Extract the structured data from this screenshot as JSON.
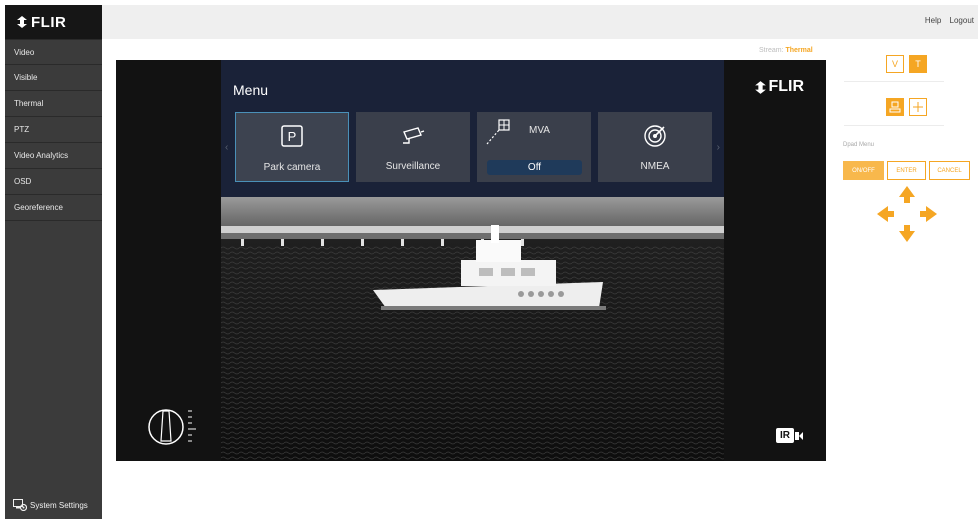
{
  "brand": {
    "logo_text": "FLIR"
  },
  "sidebar": {
    "items": [
      {
        "label": "Video"
      },
      {
        "label": "Visible"
      },
      {
        "label": "Thermal"
      },
      {
        "label": "PTZ"
      },
      {
        "label": "Video Analytics"
      },
      {
        "label": "OSD"
      },
      {
        "label": "Georeference"
      }
    ],
    "footer_label": "System Settings"
  },
  "topbar": {
    "help_label": "Help",
    "logout_label": "Logout"
  },
  "stream": {
    "label": "Stream:",
    "value": "Thermal"
  },
  "video": {
    "menu": {
      "title": "Menu",
      "items": [
        {
          "label": "Park camera",
          "icon": "park-icon",
          "selected": true
        },
        {
          "label": "Surveillance",
          "icon": "surveillance-camera-icon",
          "selected": false
        },
        {
          "label": "MVA",
          "icon": "mva-icon",
          "value": "Off",
          "selected": false
        },
        {
          "label": "NMEA",
          "icon": "nmea-radar-icon",
          "selected": false
        }
      ],
      "left_arrow": "‹",
      "right_arrow": "›"
    },
    "overlay_logo": "FLIR",
    "ir_badge": "IR"
  },
  "controls": {
    "stream_toggle": {
      "visible_label": "V",
      "thermal_label": "T"
    },
    "dpad_label": "Dpad Menu",
    "actions": [
      {
        "label": "ON/OFF",
        "filled": true
      },
      {
        "label": "ENTER",
        "filled": false
      },
      {
        "label": "CANCEL",
        "filled": false
      }
    ]
  },
  "colors": {
    "accent": "#f5a623",
    "sidebar_bg": "#3b3b3b",
    "menu_bg": "#1a2238"
  }
}
